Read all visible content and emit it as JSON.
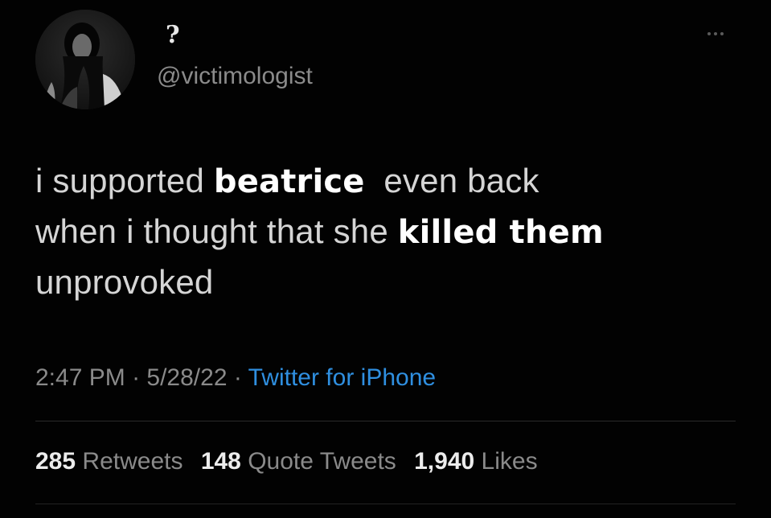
{
  "colors": {
    "background": "#020202",
    "text": "#d5d5d5",
    "muted": "#8a8a8a",
    "link": "#2f8fe0",
    "emphasis": "#ffffff"
  },
  "author": {
    "display_name": "?",
    "handle": "@victimologist",
    "avatar_icon": "profile-photo-avatar"
  },
  "menu": {
    "icon": "more-options-icon"
  },
  "tweet": {
    "line1_a": "i supported ",
    "line1_bold": "beatrice",
    "line1_b": "  even back",
    "line2_a": "when i thought that she ",
    "line2_bold": "killed them",
    "line3": "unprovoked"
  },
  "meta": {
    "time": "2:47 PM",
    "sep1": " · ",
    "date": "5/28/22",
    "sep2": " · ",
    "source": "Twitter for iPhone"
  },
  "stats": {
    "retweets_count": "285",
    "retweets_label": "Retweets",
    "quotes_count": "148",
    "quotes_label": "Quote Tweets",
    "likes_count": "1,940",
    "likes_label": "Likes"
  }
}
